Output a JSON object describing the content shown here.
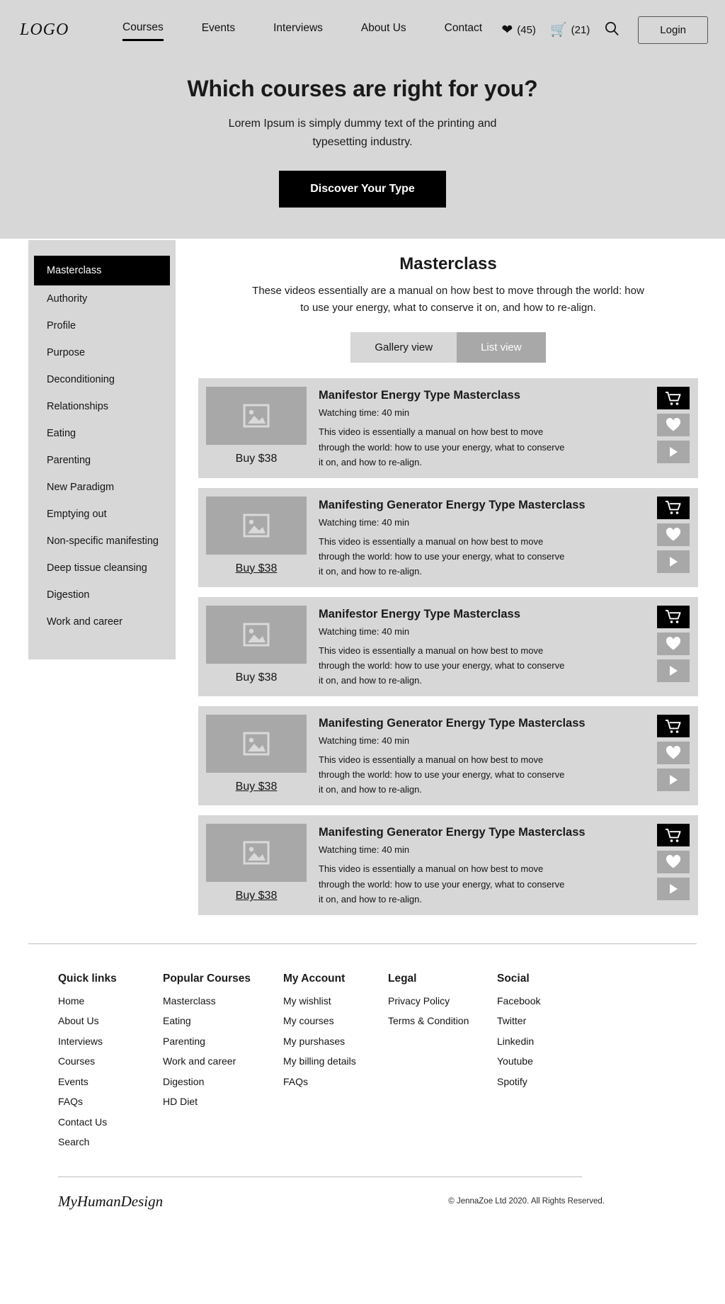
{
  "header": {
    "logo": "LOGO",
    "nav": [
      {
        "label": "Courses",
        "active": true
      },
      {
        "label": "Events",
        "active": false
      },
      {
        "label": "Interviews",
        "active": false
      },
      {
        "label": "About Us",
        "active": false
      },
      {
        "label": "Contact",
        "active": false
      }
    ],
    "wishlist_count": "(45)",
    "cart_count": "(21)",
    "login_label": "Login"
  },
  "hero": {
    "title": "Which courses are right for you?",
    "subtitle": "Lorem Ipsum is simply dummy text of the printing and typesetting industry.",
    "cta_label": "Discover Your  Type"
  },
  "sidebar": {
    "items": [
      {
        "label": "Masterclass",
        "active": true
      },
      {
        "label": "Authority",
        "active": false
      },
      {
        "label": "Profile",
        "active": false
      },
      {
        "label": "Purpose",
        "active": false
      },
      {
        "label": "Deconditioning",
        "active": false
      },
      {
        "label": "Relationships",
        "active": false
      },
      {
        "label": "Eating",
        "active": false
      },
      {
        "label": "Parenting",
        "active": false
      },
      {
        "label": "New Paradigm",
        "active": false
      },
      {
        "label": "Emptying out",
        "active": false
      },
      {
        "label": "Non-specific manifesting",
        "active": false
      },
      {
        "label": "Deep tissue cleansing",
        "active": false
      },
      {
        "label": "Digestion",
        "active": false
      },
      {
        "label": "Work and career",
        "active": false
      }
    ]
  },
  "main": {
    "title": "Masterclass",
    "description": "These videos essentially are a manual on how best to move through the world: how to use your energy, what to conserve it on, and how to re-align.",
    "view_toggle": {
      "gallery_label": "Gallery view",
      "list_label": "List view",
      "selected": "List view"
    },
    "courses": [
      {
        "title": "Manifestor Energy Type Masterclass",
        "watching_time": "Watching time: 40 min",
        "description": "This video is essentially a manual on how best to move through the world: how to use your energy, what to conserve it on, and how to re-align.",
        "buy_label": "Buy $38",
        "buy_underlined": false
      },
      {
        "title": "Manifesting Generator Energy Type Masterclass",
        "watching_time": "Watching time: 40 min",
        "description": "This video is essentially a manual on how best to move through the world: how to use your energy, what to conserve it on, and how to re-align.",
        "buy_label": "Buy $38",
        "buy_underlined": true
      },
      {
        "title": "Manifestor Energy Type Masterclass",
        "watching_time": "Watching time: 40 min",
        "description": "This video is essentially a manual on how best to move through the world: how to use your energy, what to conserve it on, and how to re-align.",
        "buy_label": "Buy $38",
        "buy_underlined": false
      },
      {
        "title": "Manifesting Generator Energy Type Masterclass",
        "watching_time": "Watching time: 40 min",
        "description": "This video is essentially a manual on how best to move through the world: how to use your energy, what to conserve it on, and how to re-align.",
        "buy_label": "Buy $38",
        "buy_underlined": true
      },
      {
        "title": "Manifesting Generator Energy Type Masterclass",
        "watching_time": "Watching time: 40 min",
        "description": "This video is essentially a manual on how best to move through the world: how to use your energy, what to conserve it on, and how to re-align.",
        "buy_label": "Buy $38",
        "buy_underlined": true
      }
    ]
  },
  "footer": {
    "columns": [
      {
        "heading": "Quick links",
        "links": [
          "Home",
          "About Us",
          "Interviews",
          "Courses",
          "Events",
          "FAQs",
          "Contact Us",
          "Search"
        ]
      },
      {
        "heading": "Popular Courses",
        "links": [
          "Masterclass",
          "Eating",
          "Parenting",
          "Work and career",
          "Digestion",
          "HD Diet"
        ]
      },
      {
        "heading": "My Account",
        "links": [
          "My wishlist",
          "My courses",
          "My purshases",
          "My billing details",
          "FAQs"
        ]
      },
      {
        "heading": "Legal",
        "links": [
          "Privacy Policy",
          "Terms & Condition"
        ]
      },
      {
        "heading": "Social",
        "links": [
          "Facebook",
          "Twitter",
          "Linkedin",
          "Youtube",
          "Spotify"
        ]
      }
    ],
    "logo": "MyHumanDesign",
    "copyright": "© JennaZoe Ltd 2020. All Rights Reserved."
  },
  "colors": {
    "hero_bg": "#d7d7d7",
    "accent_black": "#000000",
    "muted_gray": "#a8a8a8"
  }
}
